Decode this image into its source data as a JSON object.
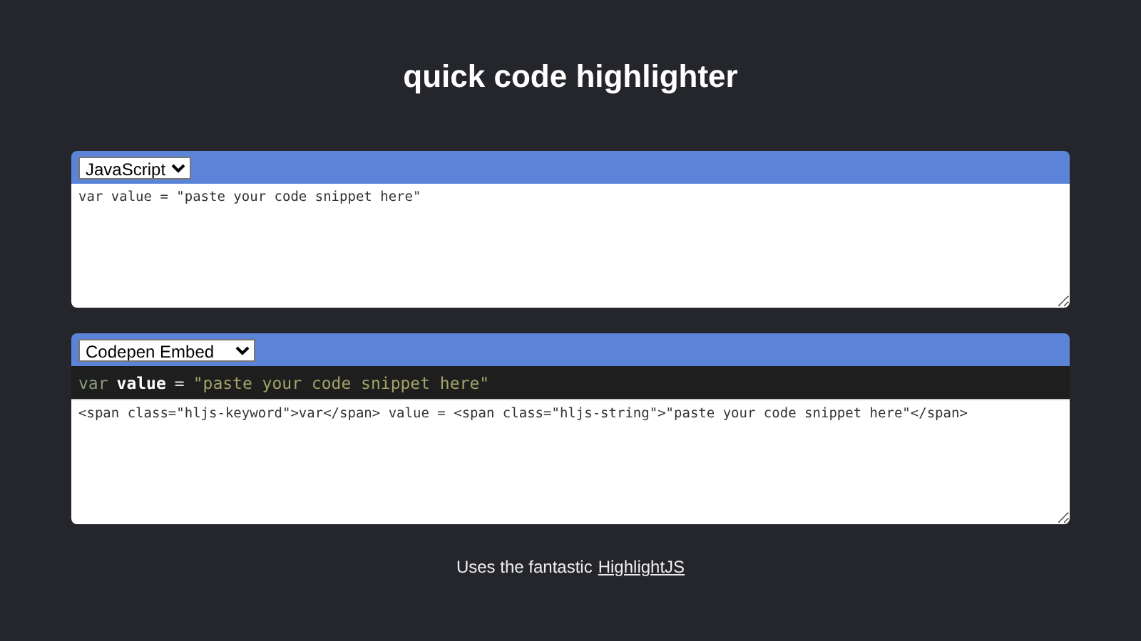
{
  "title": "quick code highlighter",
  "input_panel": {
    "language": "JavaScript",
    "code": "var value = \"paste your code snippet here\""
  },
  "output_panel": {
    "format": "Codepen Embed",
    "preview": [
      {
        "kind": "keyword",
        "text": "var"
      },
      {
        "kind": "plain",
        "text": "value"
      },
      {
        "kind": "operator",
        "text": "="
      },
      {
        "kind": "string",
        "text": "\"paste your code snippet here\""
      }
    ],
    "output": "<span class=\"hljs-keyword\">var</span> value = <span class=\"hljs-string\">\"paste your code snippet here\"</span>"
  },
  "footer": {
    "text": "Uses the fantastic",
    "link": "HighlightJS"
  }
}
